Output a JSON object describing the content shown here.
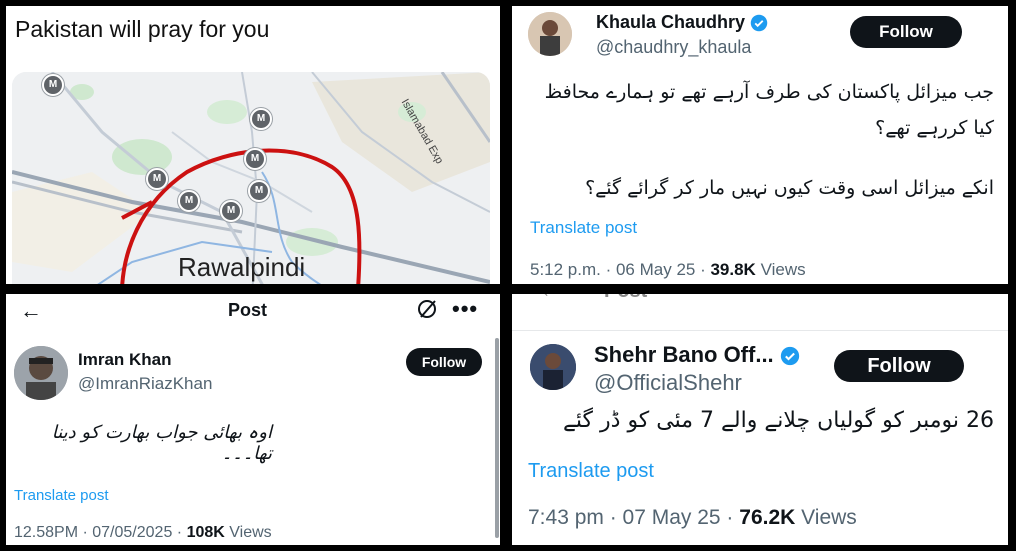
{
  "panel_map": {
    "caption": "Pakistan will pray for you",
    "city_label": "Rawalpindi",
    "road_label": "Islamabad Exp",
    "marker_glyph": "M",
    "highlight_color": "#cc1111"
  },
  "panel_khaula": {
    "name": "Khaula Chaudhry",
    "handle": "@chaudhry_khaula",
    "follow_label": "Follow",
    "text_line1": "جب میزائل پاکستان کی طرف آرہے تھے تو ہمارے محافظ",
    "text_line2": "کیا کررہے تھے؟",
    "text_line3": "انکے میزائل اسی وقت کیوں نہیں مار کر گرائے گئے؟",
    "translate": "Translate post",
    "time": "5:12 p.m. · 06 May 25 · ",
    "views_count": "39.8K",
    "views_label": " Views",
    "verified_color": "#1d9bf0"
  },
  "panel_imran": {
    "back_icon": "←",
    "title": "Post",
    "more_icon": "•••",
    "name": "Imran Khan",
    "handle": "@ImranRiazKhan",
    "follow_label": "Follow",
    "text": "اوہ بھائی جواب بھارت کو دینا تھا۔۔۔",
    "translate": "Translate post",
    "time": "12.58PM · 07/05/2025 · ",
    "views_count": "108K",
    "views_label": " Views"
  },
  "panel_shehr": {
    "top_title": "Post",
    "name": "Shehr Bano Off...",
    "handle": "@OfficialShehr",
    "follow_label": "Follow",
    "text": "26 نومبر کو گولیاں چلانے والے 7 مئی کو ڈر گئے",
    "translate": "Translate post",
    "time": "7:43 pm · 07 May 25 · ",
    "views_count": "76.2K",
    "views_label": " Views",
    "verified_color": "#1d9bf0"
  }
}
